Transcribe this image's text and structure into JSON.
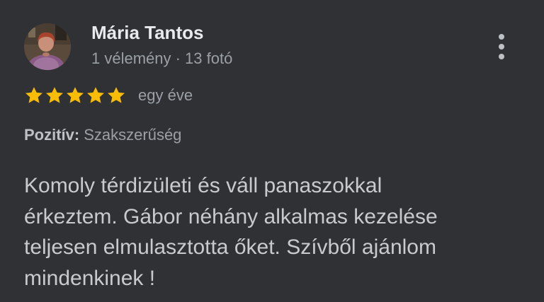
{
  "author": {
    "name": "Mária Tantos",
    "meta": "1 vélemény · 13 fotó",
    "avatar_icon": "user-photo-avatar"
  },
  "rating": {
    "stars": 5,
    "max_stars": 5,
    "star_color": "#fbbc04",
    "date": "egy éve"
  },
  "attribute": {
    "label": "Pozitív:",
    "value": "Szakszerűség"
  },
  "review_text": "Komoly térdizületi és váll panaszokkal\nérkeztem. Gábor néhány alkalmas kezelése\nteljesen elmulasztotta őket. Szívből ajánlom\nmindenkinek !",
  "menu_icon": "more-vert-icon",
  "colors": {
    "background": "#303134",
    "primary_text": "#e8eaed",
    "secondary_text": "#9aa0a6"
  }
}
